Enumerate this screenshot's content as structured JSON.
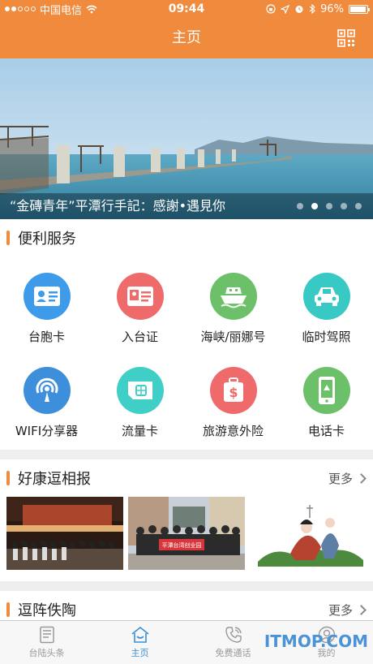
{
  "status_bar": {
    "carrier": "中国电信",
    "time": "09:44",
    "battery": "96%",
    "battery_level": 0.96
  },
  "nav": {
    "title": "主页",
    "qr_icon": "qr-code-icon"
  },
  "banner": {
    "caption": "“金磚青年”平潭行手記：感謝•遇見你",
    "page_count": 5,
    "active_page": 2
  },
  "services": {
    "title": "便利服务",
    "items": [
      {
        "label": "台胞卡",
        "icon": "id-card-icon",
        "color": "#3d9be9"
      },
      {
        "label": "入台证",
        "icon": "permit-card-icon",
        "color": "#ef6b6b"
      },
      {
        "label": "海峡/丽娜号",
        "icon": "ferry-icon",
        "color": "#6cc069"
      },
      {
        "label": "临时驾照",
        "icon": "car-icon",
        "color": "#38c9c5"
      },
      {
        "label": "WIFI分享器",
        "icon": "wifi-icon",
        "color": "#3d8fdc"
      },
      {
        "label": "流量卡",
        "icon": "sim-card-icon",
        "color": "#3fcfc7"
      },
      {
        "label": "旅游意外险",
        "icon": "insurance-icon",
        "color": "#ef6b6b"
      },
      {
        "label": "电话卡",
        "icon": "phone-card-icon",
        "color": "#6cc069"
      }
    ]
  },
  "news": {
    "title": "好康逗相报",
    "more": "更多",
    "photo_banner_text": "平潭台湾创业园"
  },
  "section3": {
    "title": "逗阵佚陶",
    "more": "更多"
  },
  "tabs": [
    {
      "label": "台陆头条",
      "icon": "news-icon"
    },
    {
      "label": "主页",
      "icon": "home-icon"
    },
    {
      "label": "免费通话",
      "icon": "phone-icon"
    },
    {
      "label": "我的",
      "icon": "profile-icon"
    }
  ],
  "watermark": "ITMOP.COM"
}
